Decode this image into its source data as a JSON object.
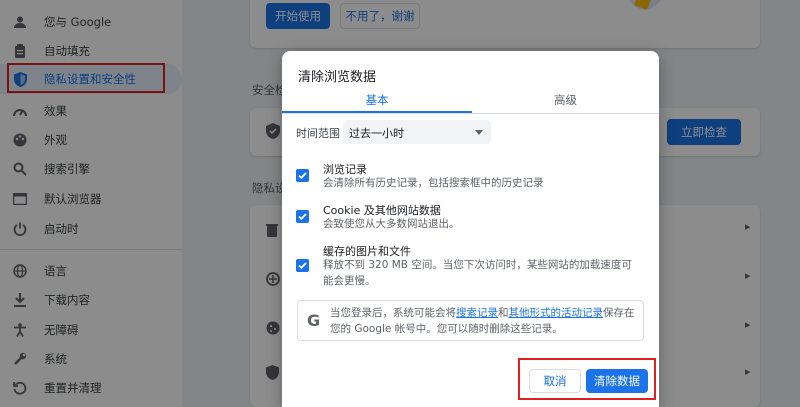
{
  "sidebar": {
    "items": [
      {
        "label": "您与 Google",
        "icon": "person-icon"
      },
      {
        "label": "自动填充",
        "icon": "clipboard-icon"
      },
      {
        "label": "隐私设置和安全性",
        "icon": "shield-icon"
      },
      {
        "label": "效果",
        "icon": "speedometer-icon"
      },
      {
        "label": "外观",
        "icon": "palette-icon"
      },
      {
        "label": "搜索引擎",
        "icon": "search-icon"
      },
      {
        "label": "默认浏览器",
        "icon": "browser-icon"
      },
      {
        "label": "启动时",
        "icon": "power-icon"
      },
      {
        "label": "语言",
        "icon": "globe-icon"
      },
      {
        "label": "下载内容",
        "icon": "download-icon"
      },
      {
        "label": "无障碍",
        "icon": "accessibility-icon"
      },
      {
        "label": "系统",
        "icon": "wrench-icon"
      },
      {
        "label": "重置并清理",
        "icon": "reset-icon"
      }
    ]
  },
  "background": {
    "start_label": "开始使用",
    "no_thanks_label": "不用了，谢谢",
    "safety_check_title": "安全检",
    "check_now_label": "立即检查",
    "privacy_title": "隐私设"
  },
  "dialog": {
    "title": "清除浏览数据",
    "tabs": {
      "basic": "基本",
      "advanced": "高级"
    },
    "time_range_label": "时间范围",
    "time_range_value": "过去一小时",
    "options": [
      {
        "title": "浏览记录",
        "desc": "会清除所有历史记录，包括搜索框中的历史记录"
      },
      {
        "title": "Cookie 及其他网站数据",
        "desc": "会致使您从大多数网站退出。"
      },
      {
        "title": "缓存的图片和文件",
        "desc": "释放不到 320 MB 空间。当您下次访问时，某些网站的加载速度可能会更慢。"
      }
    ],
    "google_notice": {
      "pre": "当您登录后，系统可能会将",
      "link1": "搜索记录",
      "mid": "和",
      "link2": "其他形式的活动记录",
      "post": "保存在您的 Google 帐号中。您可以随时删除这些记录。"
    },
    "cancel_label": "取消",
    "clear_label": "清除数据"
  },
  "colors": {
    "accent": "#1a73e8",
    "annotation": "#e02020"
  }
}
